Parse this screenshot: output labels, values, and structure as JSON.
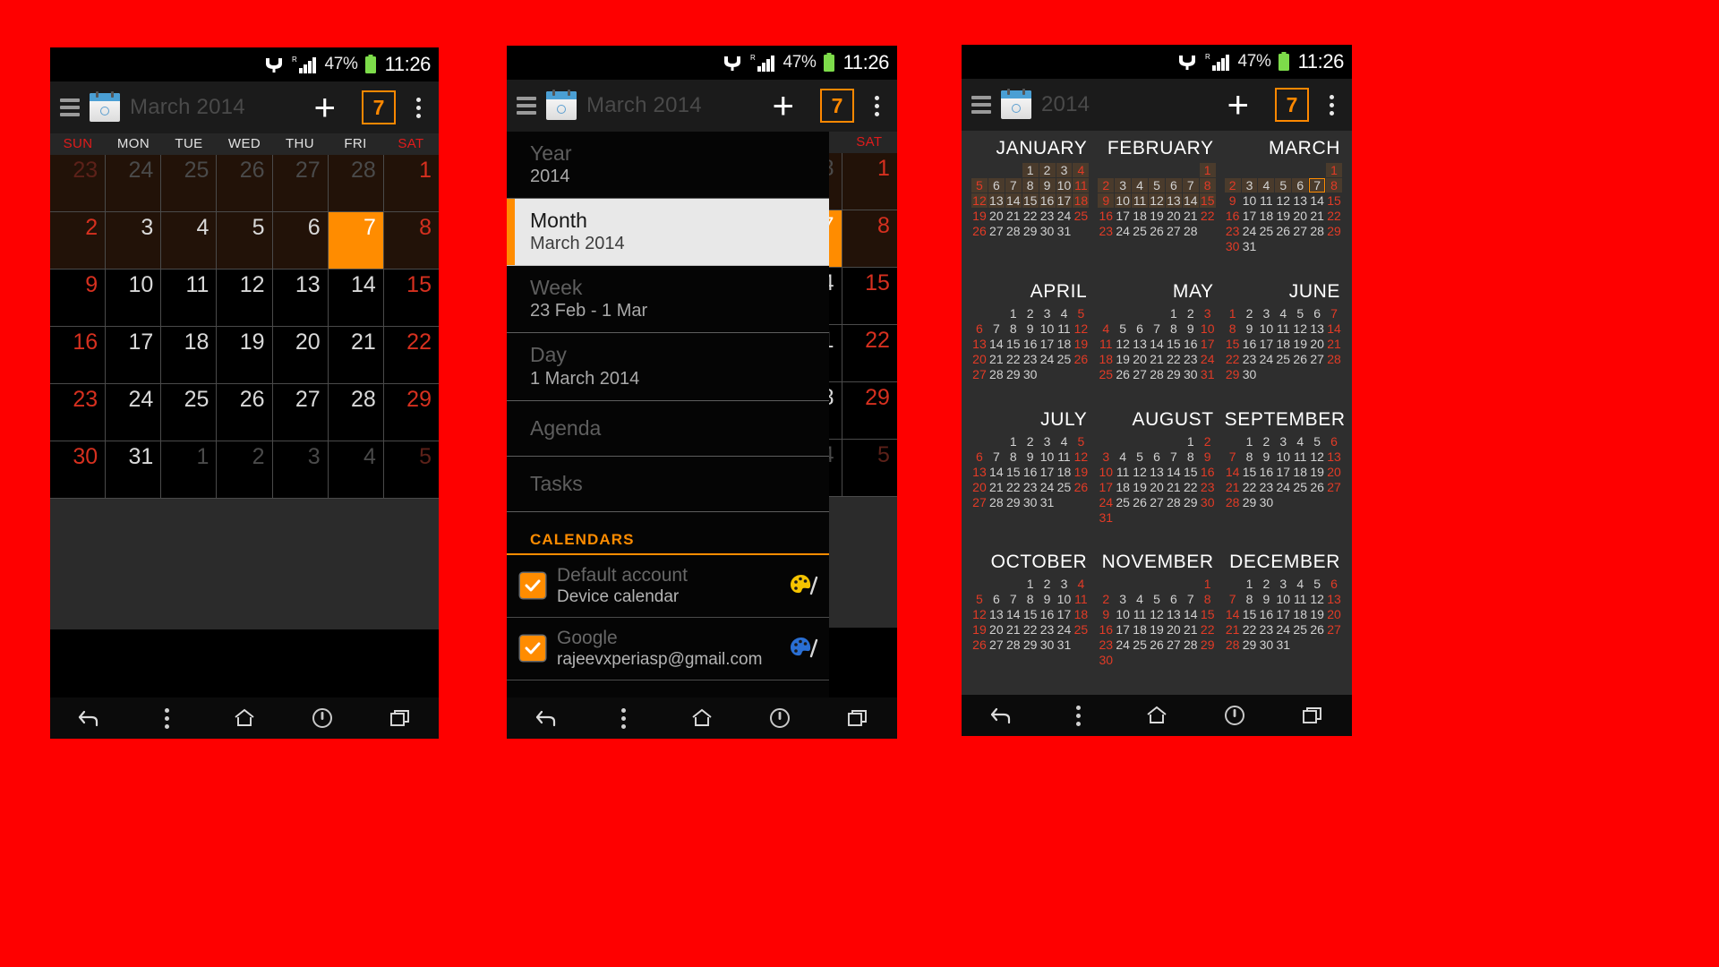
{
  "status_bar": {
    "battery_pct": "47%",
    "clock": "11:26",
    "roam_label": "R"
  },
  "panel1": {
    "title": "March 2014",
    "today_badge": "7",
    "weekdays": [
      "SUN",
      "MON",
      "TUE",
      "WED",
      "THU",
      "FRI",
      "SAT"
    ],
    "weeks": [
      {
        "tinted": true,
        "days": [
          {
            "n": "23",
            "t": "other sun"
          },
          {
            "n": "24",
            "t": "other"
          },
          {
            "n": "25",
            "t": "other"
          },
          {
            "n": "26",
            "t": "other"
          },
          {
            "n": "27",
            "t": "other"
          },
          {
            "n": "28",
            "t": "other"
          },
          {
            "n": "1",
            "t": "sat"
          }
        ]
      },
      {
        "tinted": true,
        "days": [
          {
            "n": "2",
            "t": "sun"
          },
          {
            "n": "3",
            "t": ""
          },
          {
            "n": "4",
            "t": ""
          },
          {
            "n": "5",
            "t": ""
          },
          {
            "n": "6",
            "t": ""
          },
          {
            "n": "7",
            "t": "sel"
          },
          {
            "n": "8",
            "t": "sat"
          }
        ]
      },
      {
        "tinted": false,
        "days": [
          {
            "n": "9",
            "t": "sun"
          },
          {
            "n": "10",
            "t": ""
          },
          {
            "n": "11",
            "t": ""
          },
          {
            "n": "12",
            "t": ""
          },
          {
            "n": "13",
            "t": ""
          },
          {
            "n": "14",
            "t": ""
          },
          {
            "n": "15",
            "t": "sat"
          }
        ]
      },
      {
        "tinted": false,
        "days": [
          {
            "n": "16",
            "t": "sun"
          },
          {
            "n": "17",
            "t": ""
          },
          {
            "n": "18",
            "t": ""
          },
          {
            "n": "19",
            "t": ""
          },
          {
            "n": "20",
            "t": ""
          },
          {
            "n": "21",
            "t": ""
          },
          {
            "n": "22",
            "t": "sat"
          }
        ]
      },
      {
        "tinted": false,
        "days": [
          {
            "n": "23",
            "t": "sun"
          },
          {
            "n": "24",
            "t": ""
          },
          {
            "n": "25",
            "t": ""
          },
          {
            "n": "26",
            "t": ""
          },
          {
            "n": "27",
            "t": ""
          },
          {
            "n": "28",
            "t": ""
          },
          {
            "n": "29",
            "t": "sat"
          }
        ]
      },
      {
        "tinted": false,
        "days": [
          {
            "n": "30",
            "t": "sun"
          },
          {
            "n": "31",
            "t": ""
          },
          {
            "n": "1",
            "t": "other"
          },
          {
            "n": "2",
            "t": "other"
          },
          {
            "n": "3",
            "t": "other"
          },
          {
            "n": "4",
            "t": "other"
          },
          {
            "n": "5",
            "t": "other sat"
          }
        ]
      }
    ]
  },
  "panel2": {
    "title": "March 2014",
    "today_badge": "7",
    "menu": [
      {
        "label": "Year",
        "value": "2014",
        "active": false
      },
      {
        "label": "Month",
        "value": "March 2014",
        "active": true
      },
      {
        "label": "Week",
        "value": "23 Feb - 1 Mar",
        "active": false
      },
      {
        "label": "Day",
        "value": "1 March 2014",
        "active": false
      },
      {
        "label": "Agenda",
        "value": "",
        "active": false
      },
      {
        "label": "Tasks",
        "value": "",
        "active": false
      }
    ],
    "calendars_header": "CALENDARS",
    "calendars": [
      {
        "name": "Default account",
        "sub": "Device calendar",
        "checked": true,
        "color": "#f5c400"
      },
      {
        "name": "Google",
        "sub": "rajeevxperiasp@gmail.com",
        "checked": true,
        "color": "#2a6fd4"
      }
    ]
  },
  "panel3": {
    "title": "2014",
    "today_badge": "7",
    "months": [
      {
        "name": "JANUARY",
        "lead": 3,
        "days": 31,
        "first_weekday": 3,
        "tinted_weeks": [
          0,
          1,
          2
        ]
      },
      {
        "name": "FEBRUARY",
        "lead": 6,
        "days": 28,
        "first_weekday": 6,
        "tinted_weeks": [
          0,
          1,
          2
        ]
      },
      {
        "name": "MARCH",
        "lead": 6,
        "days": 31,
        "first_weekday": 6,
        "tinted_weeks": [
          0,
          1
        ],
        "today": 7
      },
      {
        "name": "APRIL",
        "lead": 2,
        "days": 30,
        "first_weekday": 2,
        "tinted_weeks": []
      },
      {
        "name": "MAY",
        "lead": 4,
        "days": 31,
        "first_weekday": 4,
        "tinted_weeks": []
      },
      {
        "name": "JUNE",
        "lead": 0,
        "days": 30,
        "first_weekday": 0,
        "tinted_weeks": []
      },
      {
        "name": "JULY",
        "lead": 2,
        "days": 31,
        "first_weekday": 2,
        "tinted_weeks": []
      },
      {
        "name": "AUGUST",
        "lead": 5,
        "days": 31,
        "first_weekday": 5,
        "tinted_weeks": []
      },
      {
        "name": "SEPTEMBER",
        "lead": 1,
        "days": 30,
        "first_weekday": 1,
        "tinted_weeks": []
      },
      {
        "name": "OCTOBER",
        "lead": 3,
        "days": 31,
        "first_weekday": 3,
        "tinted_weeks": []
      },
      {
        "name": "NOVEMBER",
        "lead": 6,
        "days": 30,
        "first_weekday": 6,
        "tinted_weeks": []
      },
      {
        "name": "DECEMBER",
        "lead": 1,
        "days": 31,
        "first_weekday": 1,
        "tinted_weeks": []
      }
    ]
  },
  "navbar": {
    "back": "back-button",
    "menu": "menu-button",
    "home": "home-button",
    "power": "power-button",
    "recents": "recents-button"
  },
  "colors": {
    "accent": "#ff8c00",
    "weekend": "#d6301f",
    "background": "#fe0000"
  }
}
